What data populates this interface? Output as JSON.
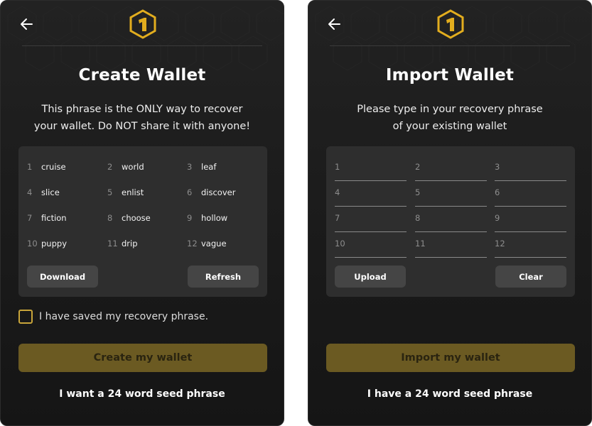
{
  "create": {
    "title": "Create Wallet",
    "subtitle_line1": "This phrase is the ONLY way to recover",
    "subtitle_line2": "your wallet. Do NOT share it with anyone!",
    "words": [
      {
        "n": "1",
        "w": "cruise"
      },
      {
        "n": "2",
        "w": "world"
      },
      {
        "n": "3",
        "w": "leaf"
      },
      {
        "n": "4",
        "w": "slice"
      },
      {
        "n": "5",
        "w": "enlist"
      },
      {
        "n": "6",
        "w": "discover"
      },
      {
        "n": "7",
        "w": "fiction"
      },
      {
        "n": "8",
        "w": "choose"
      },
      {
        "n": "9",
        "w": "hollow"
      },
      {
        "n": "10",
        "w": "puppy"
      },
      {
        "n": "11",
        "w": "drip"
      },
      {
        "n": "12",
        "w": "vague"
      }
    ],
    "download_label": "Download",
    "refresh_label": "Refresh",
    "checkbox_label": "I have saved my recovery phrase.",
    "checkbox_checked": false,
    "primary_label": "Create my wallet",
    "link_label": "I want a 24 word seed phrase"
  },
  "import": {
    "title": "Import Wallet",
    "subtitle_line1": "Please type in your recovery phrase",
    "subtitle_line2": "of your existing wallet",
    "fields": [
      "1",
      "2",
      "3",
      "4",
      "5",
      "6",
      "7",
      "8",
      "9",
      "10",
      "11",
      "12"
    ],
    "upload_label": "Upload",
    "clear_label": "Clear",
    "primary_label": "Import my wallet",
    "link_label": "I have a 24 word seed phrase"
  },
  "icons": {
    "back": "arrow-left-icon",
    "logo": "hexagon-one-logo"
  },
  "colors": {
    "accent": "#c9a53a",
    "primary_button": "#6b5a22",
    "panel_bg": "#1c1c1c",
    "box_bg": "#2e2e2e",
    "secondary_button": "#454545"
  }
}
